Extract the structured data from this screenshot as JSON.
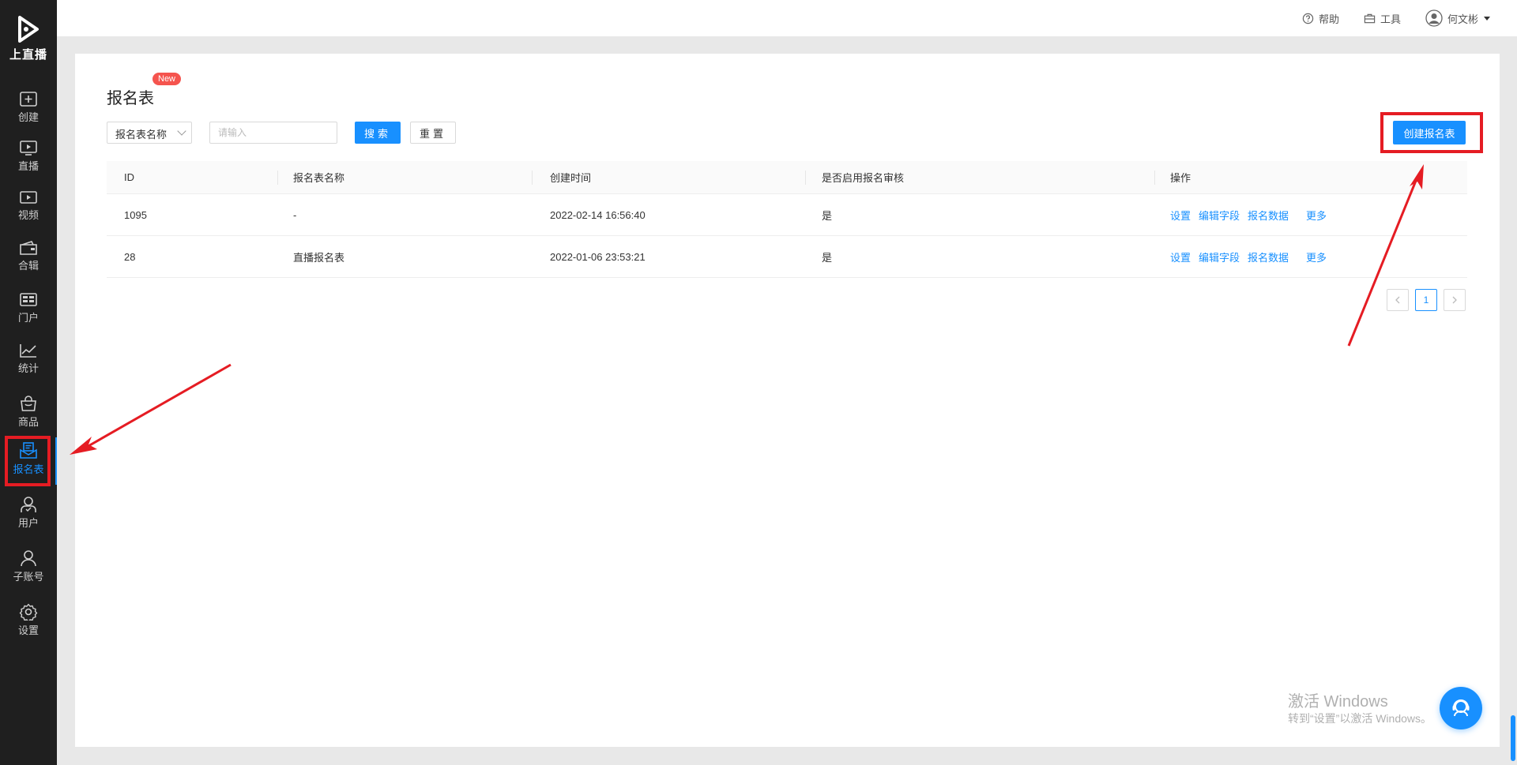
{
  "app": {
    "logo_text": "上直播"
  },
  "sidebar": {
    "items": [
      {
        "label": "创建",
        "icon": "plus-square-icon"
      },
      {
        "label": "直播",
        "icon": "play-screen-icon"
      },
      {
        "label": "视频",
        "icon": "video-icon"
      },
      {
        "label": "合辑",
        "icon": "folder-icon"
      },
      {
        "label": "门户",
        "icon": "portal-icon"
      },
      {
        "label": "统计",
        "icon": "chart-icon"
      },
      {
        "label": "商品",
        "icon": "bag-icon"
      },
      {
        "label": "报名表",
        "icon": "form-icon",
        "active": true
      },
      {
        "label": "用户",
        "icon": "user-check-icon"
      },
      {
        "label": "子账号",
        "icon": "sub-account-icon"
      },
      {
        "label": "设置",
        "icon": "gear-icon"
      }
    ]
  },
  "header": {
    "help": "帮助",
    "tools": "工具",
    "user": "何文彬"
  },
  "page": {
    "title": "报名表",
    "badge": "New"
  },
  "filter": {
    "select_value": "报名表名称",
    "input_placeholder": "请输入",
    "search_label": "搜索",
    "reset_label": "重置"
  },
  "create_button": "创建报名表",
  "table": {
    "columns": [
      "ID",
      "报名表名称",
      "创建时间",
      "是否启用报名审核",
      "操作"
    ],
    "rows": [
      {
        "id": "1095",
        "name": "-",
        "created": "2022-02-14 16:56:40",
        "review": "是"
      },
      {
        "id": "28",
        "name": "直播报名表",
        "created": "2022-01-06 23:53:21",
        "review": "是"
      }
    ],
    "actions": [
      "设置",
      "编辑字段",
      "报名数据",
      "更多"
    ]
  },
  "pagination": {
    "current": "1"
  },
  "watermark": {
    "line1": "激活 Windows",
    "line2": "转到“设置”以激活 Windows。"
  },
  "colors": {
    "accent": "#1890ff",
    "highlight": "#e51c23",
    "sidebar": "#1f1f1f",
    "badge": "#f5544e"
  }
}
